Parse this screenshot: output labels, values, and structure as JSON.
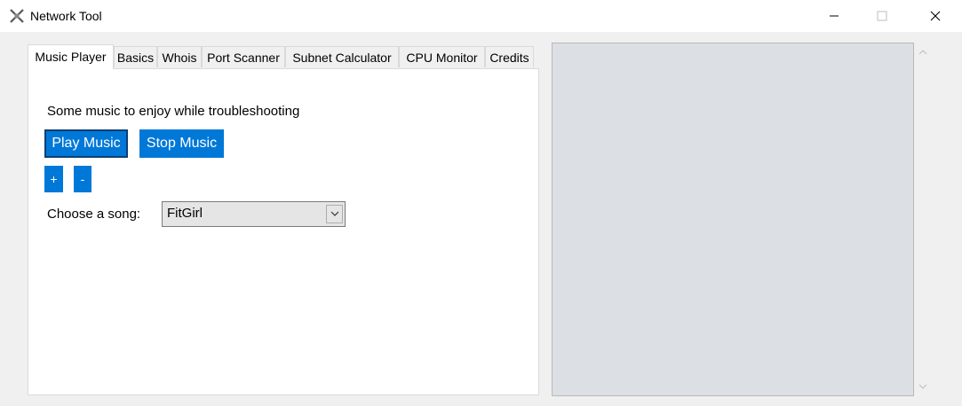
{
  "window": {
    "title": "Network Tool",
    "icon": "network-tool-icon"
  },
  "tabs": [
    {
      "label": "Music Player",
      "active": true
    },
    {
      "label": "Basics",
      "active": false
    },
    {
      "label": "Whois",
      "active": false
    },
    {
      "label": "Port Scanner",
      "active": false
    },
    {
      "label": "Subnet Calculator",
      "active": false
    },
    {
      "label": "CPU Monitor",
      "active": false
    },
    {
      "label": "Credits",
      "active": false
    }
  ],
  "music_player": {
    "intro_text": "Some music to enjoy while troubleshooting",
    "play_label": "Play Music",
    "stop_label": "Stop Music",
    "volume_up_label": "+",
    "volume_down_label": "-",
    "song_label": "Choose a song:",
    "selected_song": "FitGirl"
  },
  "colors": {
    "accent": "#0078d7",
    "pane": "#dcdfe4",
    "chrome": "#f0f0f0"
  }
}
